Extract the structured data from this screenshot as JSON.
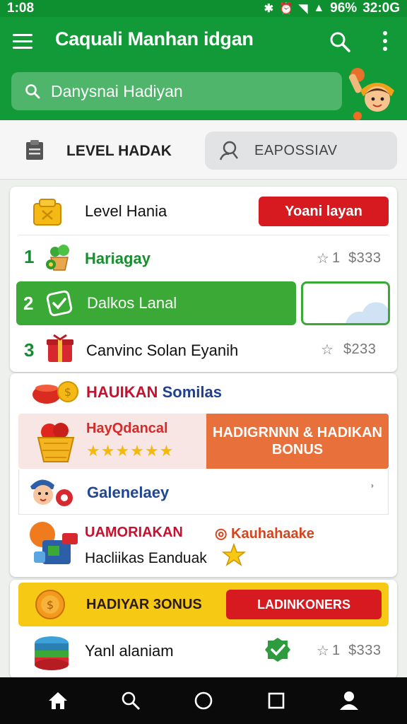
{
  "status_bar": {
    "time": "1:08",
    "battery": "96%",
    "clock_right": "32:0G"
  },
  "app_bar": {
    "title": "Caquali Manhan idgan",
    "search_placeholder": "Danysnai Hadiyan",
    "icons": [
      "menu-icon",
      "search-icon",
      "more-vert-icon"
    ]
  },
  "level_strip": {
    "label": "LEVEL HADAK",
    "search_label": "EAPOSSIAV"
  },
  "levels_card": {
    "header_title": "Level Hania",
    "header_button": "Yoani layan",
    "rows": [
      {
        "num": "1",
        "name": "Hariagay",
        "rating": "1",
        "amount": "$333"
      },
      {
        "num": "2",
        "name": "Dalkos Lanal"
      },
      {
        "num": "3",
        "name": "Canvinc Solan Eyanih",
        "amount": "$233"
      }
    ]
  },
  "promo_card": {
    "title_part1": "HAUIKAN",
    "title_part2": "Somilas",
    "promo_title": "HayQdancal",
    "promo_stars": "★★★★★★",
    "promo_cta": "HADIGRNNN & HADIKAN BONUS",
    "sub_item": "Galenelaey",
    "sub_arrow": "ʾ",
    "bottom_title": "UAMORIAKAN",
    "bottom_right": "Kauhahaake",
    "bottom_right_prefix": "◎",
    "bottom_text": "Hacliikas Eanduak"
  },
  "bonus_card": {
    "bonus_title": "HADIYAR 3ONUS",
    "bonus_button": "LADINKONERS",
    "item_name": "Yanl alaniam",
    "rating": "1",
    "amount": "$333"
  },
  "colors": {
    "primary_green": "#139a38",
    "accent_red": "#d71920",
    "accent_orange": "#e8703a",
    "bonus_yellow": "#f6c915"
  },
  "nav_bar": {
    "items": [
      "home-icon",
      "search-icon",
      "circle-home-icon",
      "square-recents-icon",
      "person-icon"
    ]
  }
}
